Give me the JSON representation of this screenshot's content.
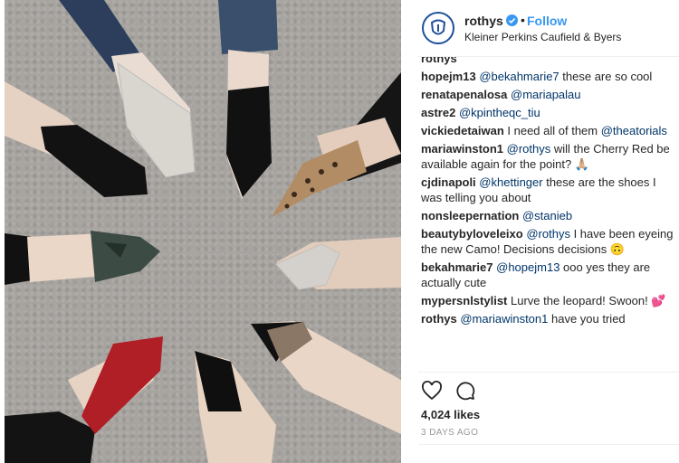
{
  "header": {
    "username": "rothys",
    "dot": "•",
    "follow_label": "Follow",
    "location": "Kleiner Perkins Caufield & Byers"
  },
  "comments": [
    {
      "user": "rothys",
      "mention": "",
      "text": "",
      "partial": true
    },
    {
      "user": "hopejm13",
      "mention": "@bekahmarie7",
      "text": " these are so cool"
    },
    {
      "user": "renatapenalosa",
      "mention": "@mariapalau",
      "text": ""
    },
    {
      "user": "astre2",
      "mention": "@kpintheqc_tiu",
      "text": ""
    },
    {
      "user": "vickiedetaiwan",
      "mention": "",
      "text": " I need all of them ",
      "mention2": "@theatorials"
    },
    {
      "user": "mariawinston1",
      "mention": "@rothys",
      "text": " will the Cherry Red be available again for the point? 🙏🏼"
    },
    {
      "user": "cjdinapoli",
      "mention": "@khettinger",
      "text": " these are the shoes I was telling you about"
    },
    {
      "user": "nonsleepernation",
      "mention": "@stanieb",
      "text": ""
    },
    {
      "user": "beautybyloveleixo",
      "mention": "@rothys",
      "text": " I have been eyeing the new Camo! Decisions decisions 🙃"
    },
    {
      "user": "bekahmarie7",
      "mention": "@hopejm13",
      "text": " ooo yes they are actually cute"
    },
    {
      "user": "mypersnlstylist",
      "mention": "",
      "text": " Lurve the leopard! Swoon! 💕"
    },
    {
      "user": "rothys",
      "mention": "@mariawinston1",
      "text": " have you tried"
    }
  ],
  "actions": {
    "like_icon": "heart-icon",
    "comment_icon": "comment-icon"
  },
  "likes": "4,024 likes",
  "time": "3 DAYS AGO",
  "colors": {
    "follow": "#3897f0",
    "mention": "#003569",
    "verified": "#3897f0",
    "avatar_ring": "#1f4f9c"
  }
}
